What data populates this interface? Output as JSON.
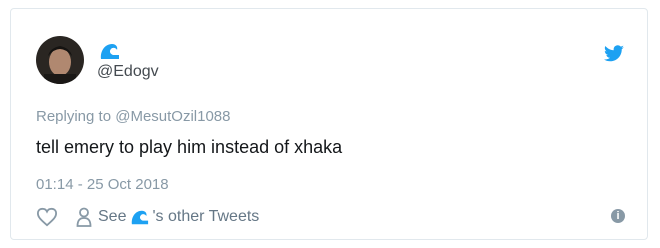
{
  "tweet": {
    "handle": "@Edogv",
    "reply_prefix": "Replying to ",
    "reply_to": "@MesutOzil1088",
    "text": "tell emery to play him instead of xhaka",
    "timestamp": "01:14 - 25 Oct 2018"
  },
  "actions": {
    "see_label": "See",
    "other_tweets_label": "'s other Tweets"
  },
  "info_symbol": "i",
  "colors": {
    "brand_blue": "#1da1f2",
    "muted_text": "#8899a6",
    "main_text": "#14171a"
  },
  "icons": [
    "wave-emoji-icon",
    "twitter-bird-icon",
    "heart-icon",
    "person-icon",
    "info-icon"
  ]
}
